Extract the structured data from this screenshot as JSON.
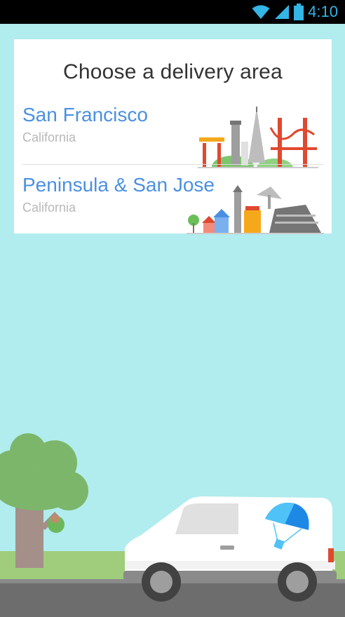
{
  "status_bar": {
    "time": "4:10",
    "icons": [
      "wifi-icon",
      "signal-icon",
      "battery-icon"
    ]
  },
  "card": {
    "title": "Choose a delivery area",
    "areas": [
      {
        "city": "San Francisco",
        "state": "California"
      },
      {
        "city": "Peninsula & San Jose",
        "state": "California"
      }
    ]
  },
  "colors": {
    "background": "#b1ecee",
    "city_text": "#4a90e2",
    "state_text": "#b8b8b8",
    "status_time": "#33b5e5"
  }
}
